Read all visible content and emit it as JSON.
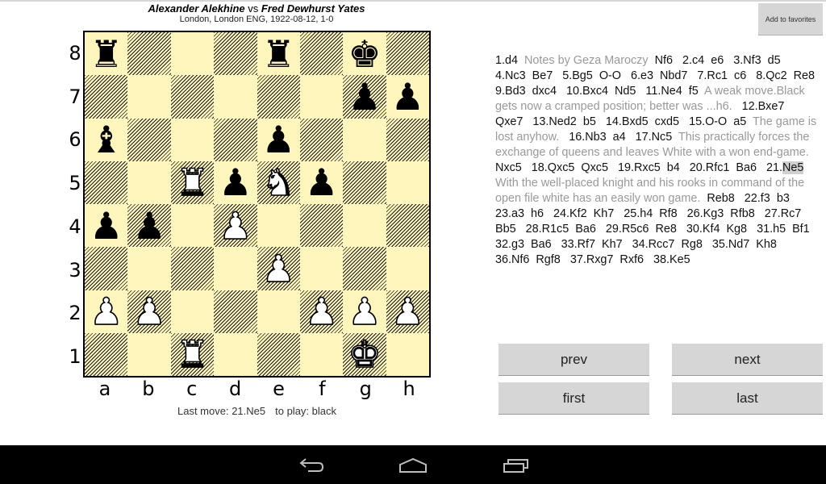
{
  "header": {
    "white_player": "Alexander Alekhine",
    "vs": "vs",
    "black_player": "Fred Dewhurst Yates",
    "game_info": "London, London ENG, 1922-08-12, 1-0"
  },
  "toolbar": {
    "favorites_label": "Add to favorites"
  },
  "board": {
    "ranks": [
      "8",
      "7",
      "6",
      "5",
      "4",
      "3",
      "2",
      "1"
    ],
    "files": [
      "a",
      "b",
      "c",
      "d",
      "e",
      "f",
      "g",
      "h"
    ],
    "pieces": [
      {
        "square": "a8",
        "piece": "rook",
        "color": "black",
        "glyph": "♜"
      },
      {
        "square": "e8",
        "piece": "rook",
        "color": "black",
        "glyph": "♜"
      },
      {
        "square": "g8",
        "piece": "king",
        "color": "black",
        "glyph": "♚"
      },
      {
        "square": "g7",
        "piece": "pawn",
        "color": "black",
        "glyph": "♟"
      },
      {
        "square": "h7",
        "piece": "pawn",
        "color": "black",
        "glyph": "♟"
      },
      {
        "square": "a6",
        "piece": "bishop",
        "color": "black",
        "glyph": "♝"
      },
      {
        "square": "e6",
        "piece": "pawn",
        "color": "black",
        "glyph": "♟"
      },
      {
        "square": "c5",
        "piece": "rook",
        "color": "white",
        "glyph": "♜"
      },
      {
        "square": "d5",
        "piece": "pawn",
        "color": "black",
        "glyph": "♟"
      },
      {
        "square": "e5",
        "piece": "knight",
        "color": "white",
        "glyph": "♞"
      },
      {
        "square": "f5",
        "piece": "pawn",
        "color": "black",
        "glyph": "♟"
      },
      {
        "square": "a4",
        "piece": "pawn",
        "color": "black",
        "glyph": "♟"
      },
      {
        "square": "b4",
        "piece": "pawn",
        "color": "black",
        "glyph": "♟"
      },
      {
        "square": "d4",
        "piece": "pawn",
        "color": "white",
        "glyph": "♟"
      },
      {
        "square": "e3",
        "piece": "pawn",
        "color": "white",
        "glyph": "♟"
      },
      {
        "square": "a2",
        "piece": "pawn",
        "color": "white",
        "glyph": "♟"
      },
      {
        "square": "b2",
        "piece": "pawn",
        "color": "white",
        "glyph": "♟"
      },
      {
        "square": "f2",
        "piece": "pawn",
        "color": "white",
        "glyph": "♟"
      },
      {
        "square": "g2",
        "piece": "pawn",
        "color": "white",
        "glyph": "♟"
      },
      {
        "square": "h2",
        "piece": "pawn",
        "color": "white",
        "glyph": "♟"
      },
      {
        "square": "c1",
        "piece": "rook",
        "color": "white",
        "glyph": "♜"
      },
      {
        "square": "g1",
        "piece": "king",
        "color": "white",
        "glyph": "♚"
      }
    ]
  },
  "status": {
    "last_move": "Last move: 21.Ne5",
    "to_play": "to play: black"
  },
  "notation": {
    "tokens": [
      {
        "t": "1.d4",
        "k": "m"
      },
      {
        "t": "Notes by Geza Maroczy",
        "k": "c"
      },
      {
        "t": "Nf6",
        "k": "m"
      },
      {
        "t": "2.c4",
        "k": "m"
      },
      {
        "t": "e6",
        "k": "m"
      },
      {
        "t": "3.Nf3",
        "k": "m"
      },
      {
        "t": "d5",
        "k": "m"
      },
      {
        "t": "4.Nc3",
        "k": "m"
      },
      {
        "t": "Be7",
        "k": "m"
      },
      {
        "t": "5.Bg5",
        "k": "m"
      },
      {
        "t": "O-O",
        "k": "m"
      },
      {
        "t": "6.e3",
        "k": "m"
      },
      {
        "t": "Nbd7",
        "k": "m"
      },
      {
        "t": "7.Rc1",
        "k": "m"
      },
      {
        "t": "c6",
        "k": "m"
      },
      {
        "t": "8.Qc2",
        "k": "m"
      },
      {
        "t": "Re8",
        "k": "m"
      },
      {
        "t": "9.Bd3",
        "k": "m"
      },
      {
        "t": "dxc4",
        "k": "m"
      },
      {
        "t": "10.Bxc4",
        "k": "m"
      },
      {
        "t": "Nd5",
        "k": "m"
      },
      {
        "t": "11.Ne4",
        "k": "m"
      },
      {
        "t": "f5",
        "k": "m"
      },
      {
        "t": "A weak move.Black gets now a cramped position; better was ...h6.",
        "k": "c"
      },
      {
        "t": "12.Bxe7",
        "k": "m"
      },
      {
        "t": "Qxe7",
        "k": "m"
      },
      {
        "t": "13.Ned2",
        "k": "m"
      },
      {
        "t": "b5",
        "k": "m"
      },
      {
        "t": "14.Bxd5",
        "k": "m"
      },
      {
        "t": "cxd5",
        "k": "m"
      },
      {
        "t": "15.O-O",
        "k": "m"
      },
      {
        "t": "a5",
        "k": "m"
      },
      {
        "t": "The game is lost anyhow.",
        "k": "c"
      },
      {
        "t": "16.Nb3",
        "k": "m"
      },
      {
        "t": "a4",
        "k": "m"
      },
      {
        "t": "17.Nc5",
        "k": "m"
      },
      {
        "t": "This practically forces the exchange of queens and leaves White with a won end-game.",
        "k": "c"
      },
      {
        "t": "Nxc5",
        "k": "m"
      },
      {
        "t": "18.Qxc5",
        "k": "m"
      },
      {
        "t": "Qxc5",
        "k": "m"
      },
      {
        "t": "19.Rxc5",
        "k": "m"
      },
      {
        "t": "b4",
        "k": "m"
      },
      {
        "t": "20.Rfc1",
        "k": "m"
      },
      {
        "t": "Ba6",
        "k": "m"
      },
      {
        "t": "21.",
        "k": "m"
      },
      {
        "t": "Ne5",
        "k": "cur"
      },
      {
        "t": "With the well-placed knight and his rooks in command of the open file white has an easily won game.",
        "k": "c"
      },
      {
        "t": "Reb8",
        "k": "m"
      },
      {
        "t": "22.f3",
        "k": "m"
      },
      {
        "t": "b3",
        "k": "m"
      },
      {
        "t": "23.a3",
        "k": "m"
      },
      {
        "t": "h6",
        "k": "m"
      },
      {
        "t": "24.Kf2",
        "k": "m"
      },
      {
        "t": "Kh7",
        "k": "m"
      },
      {
        "t": "25.h4",
        "k": "m"
      },
      {
        "t": "Rf8",
        "k": "m"
      },
      {
        "t": "26.Kg3",
        "k": "m"
      },
      {
        "t": "Rfb8",
        "k": "m"
      },
      {
        "t": "27.Rc7",
        "k": "m"
      },
      {
        "t": "Bb5",
        "k": "m"
      },
      {
        "t": "28.R1c5",
        "k": "m"
      },
      {
        "t": "Ba6",
        "k": "m"
      },
      {
        "t": "29.R5c6",
        "k": "m"
      },
      {
        "t": "Re8",
        "k": "m"
      },
      {
        "t": "30.Kf4",
        "k": "m"
      },
      {
        "t": "Kg8",
        "k": "m"
      },
      {
        "t": "31.h5",
        "k": "m"
      },
      {
        "t": "Bf1",
        "k": "m"
      },
      {
        "t": "32.g3",
        "k": "m"
      },
      {
        "t": "Ba6",
        "k": "m"
      },
      {
        "t": "33.Rf7",
        "k": "m"
      },
      {
        "t": "Kh7",
        "k": "m"
      },
      {
        "t": "34.Rcc7",
        "k": "m"
      },
      {
        "t": "Rg8",
        "k": "m"
      },
      {
        "t": "35.Nd7",
        "k": "m"
      },
      {
        "t": "Kh8",
        "k": "m"
      },
      {
        "t": "36.Nf6",
        "k": "m"
      },
      {
        "t": "Rgf8",
        "k": "m"
      },
      {
        "t": "37.Rxg7",
        "k": "m"
      },
      {
        "t": "Rxf6",
        "k": "m"
      },
      {
        "t": "38.Ke5",
        "k": "m"
      }
    ],
    "current_move": "21.Ne5"
  },
  "navigation": {
    "prev_label": "prev",
    "next_label": "next",
    "first_label": "first",
    "last_label": "last"
  },
  "system_bar": {
    "icons": [
      "back-icon",
      "home-icon",
      "recent-apps-icon"
    ]
  },
  "colors": {
    "board_light": "#fff6bd",
    "board_hatch": "#1a1a1a",
    "comment_text": "#999999",
    "current_move_highlight": "#d0d0d0",
    "button_bg": "#d6d6d6",
    "system_bar_bg": "#000000"
  }
}
